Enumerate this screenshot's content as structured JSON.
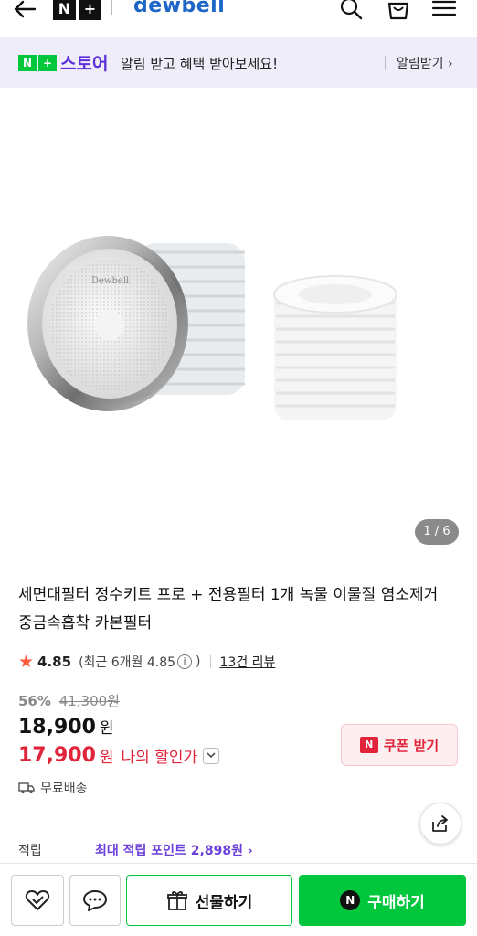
{
  "header": {
    "back_icon": "arrow-left-icon",
    "nplus_letters": [
      "N",
      "+"
    ],
    "brand": "dewbell",
    "icons": [
      "search-icon",
      "bag-icon",
      "menu-icon"
    ]
  },
  "notification": {
    "badge_n": "N",
    "badge_plus": "+",
    "store_label": "스토어",
    "message": "알림 받고 혜택 받아보세요!",
    "link_label": "알림받기 ›"
  },
  "gallery": {
    "pager": "1 / 6",
    "logo_text": "Dewbell"
  },
  "product": {
    "title": "세면대필터 정수키트 프로 + 전용필터 1개 녹물 이물질 염소제거 중금속흡착 카본필터",
    "rating": "4.85",
    "recent_rating": "(최근 6개월 4.85",
    "recent_close": ")",
    "info_glyph": "i",
    "reviews": "13건 리뷰",
    "discount_pct": "56%",
    "original_price": "41,300원",
    "price": "18,900",
    "currency": "원",
    "my_price": "17,900",
    "my_price_label": "나의 할인가",
    "coupon_label": "쿠폰 받기",
    "coupon_icon_letter": "N",
    "shipping": "무료배송",
    "points_label": "적립",
    "points_value": "최대 적립 포인트 2,898원 ›"
  },
  "bottom_bar": {
    "gift_label": "선물하기",
    "buy_label": "구매하기",
    "buy_icon_letter": "N"
  },
  "colors": {
    "naver_green": "#00c73c",
    "store_purple": "#5b2fd9",
    "discount_red": "#e0253b",
    "brand_blue": "#1e67c8",
    "star": "#ff5a3c"
  }
}
